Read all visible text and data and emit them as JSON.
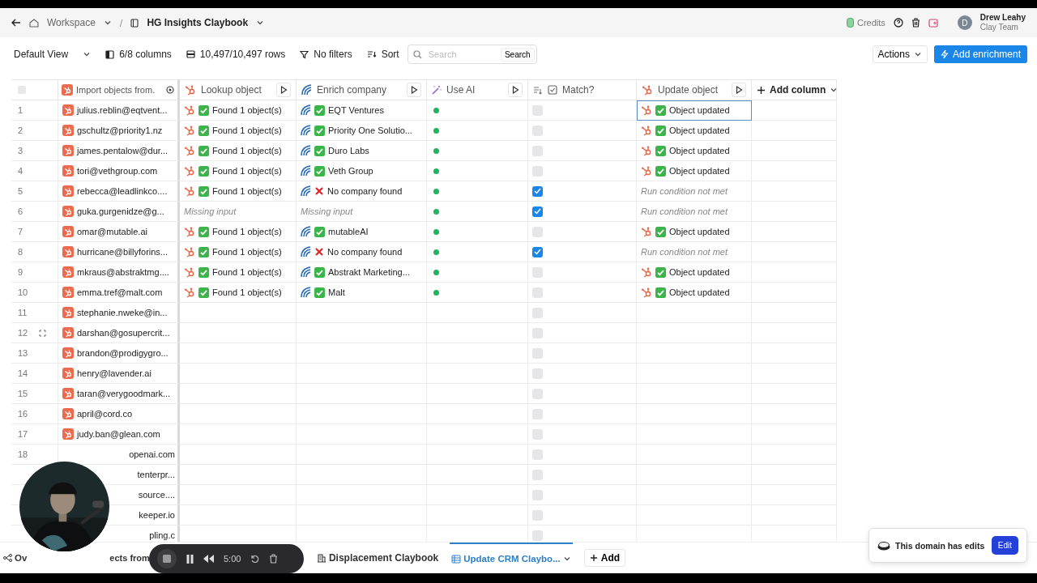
{
  "header": {
    "breadcrumbs": [
      {
        "label": "Workspace",
        "kind": "workspace"
      },
      {
        "label": "HG Insights Claybook",
        "kind": "doc"
      }
    ],
    "separator": "/",
    "credits": "Credits",
    "user": {
      "initial": "D",
      "name": "Drew Leahy",
      "team": "Clay Team"
    }
  },
  "toolbar": {
    "view": "Default View",
    "columns": "6/8 columns",
    "rows": "10,497/10,497 rows",
    "filters": "No filters",
    "sort": "Sort",
    "search": {
      "placeholder": "Search",
      "button": "Search"
    },
    "actions": "Actions",
    "add_enrichment": "Add enrichment"
  },
  "table": {
    "select_all": false,
    "columns": [
      {
        "label": "Import objects from.",
        "kind": "import",
        "run": false
      },
      {
        "label": "Lookup object",
        "kind": "hubspot",
        "run": true
      },
      {
        "label": "Enrich company",
        "kind": "enrich",
        "run": true
      },
      {
        "label": "Use AI",
        "kind": "ai",
        "run": true
      },
      {
        "label": "Match?",
        "kind": "match",
        "run": false
      },
      {
        "label": "Update object",
        "kind": "hubspot",
        "run": true
      }
    ],
    "add_column": "Add column",
    "rows": [
      {
        "n": "1",
        "email": "julius.reblin@eqtvent...",
        "kind": "full",
        "lookup": {
          "kind": "found",
          "text": "Found 1 object(s)"
        },
        "enrich": {
          "kind": "found",
          "text": "EQT Ventures"
        },
        "ai_done": true,
        "match": false,
        "update": {
          "kind": "updated",
          "text": "Object updated"
        },
        "selected": true,
        "hovered": false
      },
      {
        "n": "2",
        "email": "gschultz@priority1.nz",
        "kind": "full",
        "lookup": {
          "kind": "found",
          "text": "Found 1 object(s)"
        },
        "enrich": {
          "kind": "found",
          "text": "Priority One Solutio..."
        },
        "ai_done": true,
        "match": false,
        "update": {
          "kind": "updated",
          "text": "Object updated"
        },
        "selected": false,
        "hovered": false
      },
      {
        "n": "3",
        "email": "james.pentalow@dur...",
        "kind": "full",
        "lookup": {
          "kind": "found",
          "text": "Found 1 object(s)"
        },
        "enrich": {
          "kind": "found",
          "text": "Duro Labs"
        },
        "ai_done": true,
        "match": false,
        "update": {
          "kind": "updated",
          "text": "Object updated"
        },
        "selected": false,
        "hovered": false
      },
      {
        "n": "4",
        "email": "tori@vethgroup.com",
        "kind": "full",
        "lookup": {
          "kind": "found",
          "text": "Found 1 object(s)"
        },
        "enrich": {
          "kind": "found",
          "text": "Veth Group"
        },
        "ai_done": true,
        "match": false,
        "update": {
          "kind": "updated",
          "text": "Object updated"
        },
        "selected": false,
        "hovered": false
      },
      {
        "n": "5",
        "email": "rebecca@leadlinkco....",
        "kind": "full",
        "lookup": {
          "kind": "found",
          "text": "Found 1 object(s)"
        },
        "enrich": {
          "kind": "notfound",
          "text": "No company found"
        },
        "ai_done": true,
        "match": true,
        "update": {
          "kind": "condition",
          "text": "Run condition not met"
        },
        "selected": false,
        "hovered": false
      },
      {
        "n": "6",
        "email": "guka.gurgenidze@g...",
        "kind": "full",
        "lookup": {
          "kind": "missing",
          "text": "Missing input"
        },
        "enrich": {
          "kind": "missing",
          "text": "Missing input"
        },
        "ai_done": true,
        "match": true,
        "update": {
          "kind": "condition",
          "text": "Run condition not met"
        },
        "selected": false,
        "hovered": false
      },
      {
        "n": "7",
        "email": "omar@mutable.ai",
        "kind": "full",
        "lookup": {
          "kind": "found",
          "text": "Found 1 object(s)"
        },
        "enrich": {
          "kind": "found",
          "text": "mutableAI"
        },
        "ai_done": true,
        "match": false,
        "update": {
          "kind": "updated",
          "text": "Object updated"
        },
        "selected": false,
        "hovered": false
      },
      {
        "n": "8",
        "email": "hurricane@billyforins...",
        "kind": "full",
        "lookup": {
          "kind": "found",
          "text": "Found 1 object(s)"
        },
        "enrich": {
          "kind": "notfound",
          "text": "No company found"
        },
        "ai_done": true,
        "match": true,
        "update": {
          "kind": "condition",
          "text": "Run condition not met"
        },
        "selected": false,
        "hovered": false
      },
      {
        "n": "9",
        "email": "mkraus@abstraktmg....",
        "kind": "full",
        "lookup": {
          "kind": "found",
          "text": "Found 1 object(s)"
        },
        "enrich": {
          "kind": "found",
          "text": "Abstrakt Marketing..."
        },
        "ai_done": true,
        "match": false,
        "update": {
          "kind": "updated",
          "text": "Object updated"
        },
        "selected": false,
        "hovered": false
      },
      {
        "n": "10",
        "email": "emma.tref@malt.com",
        "kind": "full",
        "lookup": {
          "kind": "found",
          "text": "Found 1 object(s)"
        },
        "enrich": {
          "kind": "found",
          "text": "Malt"
        },
        "ai_done": true,
        "match": false,
        "update": {
          "kind": "updated",
          "text": "Object updated"
        },
        "selected": false,
        "hovered": false
      },
      {
        "n": "11",
        "email": "stephanie.nweke@in...",
        "kind": "full",
        "ai_done": false,
        "match": false,
        "selected": false,
        "hovered": false
      },
      {
        "n": "12",
        "email": "darshan@gosupercrit...",
        "kind": "full",
        "ai_done": false,
        "match": false,
        "selected": false,
        "hovered": true
      },
      {
        "n": "13",
        "email": "brandon@prodigygro...",
        "kind": "full",
        "ai_done": false,
        "match": false,
        "selected": false,
        "hovered": false
      },
      {
        "n": "14",
        "email": "henry@lavender.ai",
        "kind": "full",
        "ai_done": false,
        "match": false,
        "selected": false,
        "hovered": false
      },
      {
        "n": "15",
        "email": "taran@verygoodmark...",
        "kind": "full",
        "ai_done": false,
        "match": false,
        "selected": false,
        "hovered": false
      },
      {
        "n": "16",
        "email": "april@cord.co",
        "kind": "full",
        "ai_done": false,
        "match": false,
        "selected": false,
        "hovered": false
      },
      {
        "n": "17",
        "email": "judy.ban@glean.com",
        "kind": "full",
        "ai_done": false,
        "match": false,
        "selected": false,
        "hovered": false
      },
      {
        "n": "18",
        "email": "openai.com",
        "kind": "partial",
        "ai_done": false,
        "match": false,
        "selected": false
      },
      {
        "email": "tenterpr...",
        "kind": "partial",
        "ai_done": false,
        "match": false,
        "selected": false
      },
      {
        "email": "source....",
        "kind": "partial",
        "ai_done": false,
        "match": false,
        "selected": false
      },
      {
        "email": "keeper.io",
        "kind": "partial",
        "ai_done": false,
        "match": false,
        "selected": false
      },
      {
        "email": "pling.c",
        "kind": "partial",
        "ai_done": false,
        "match": false,
        "selected": false
      }
    ]
  },
  "sheet_tabs": [
    {
      "label": "Ov",
      "kind": "overview",
      "selected": false
    },
    {
      "label": "ects from",
      "kind": "plain",
      "selected": false
    },
    {
      "label": "Displacement Claybook",
      "kind": "company",
      "selected": false
    },
    {
      "label": "Update CRM Claybo...",
      "kind": "table",
      "selected": true
    }
  ],
  "add_tab": "Add",
  "recorder": {
    "time": "5:00"
  },
  "toast": {
    "message": "This domain has edits",
    "button": "Edit"
  }
}
